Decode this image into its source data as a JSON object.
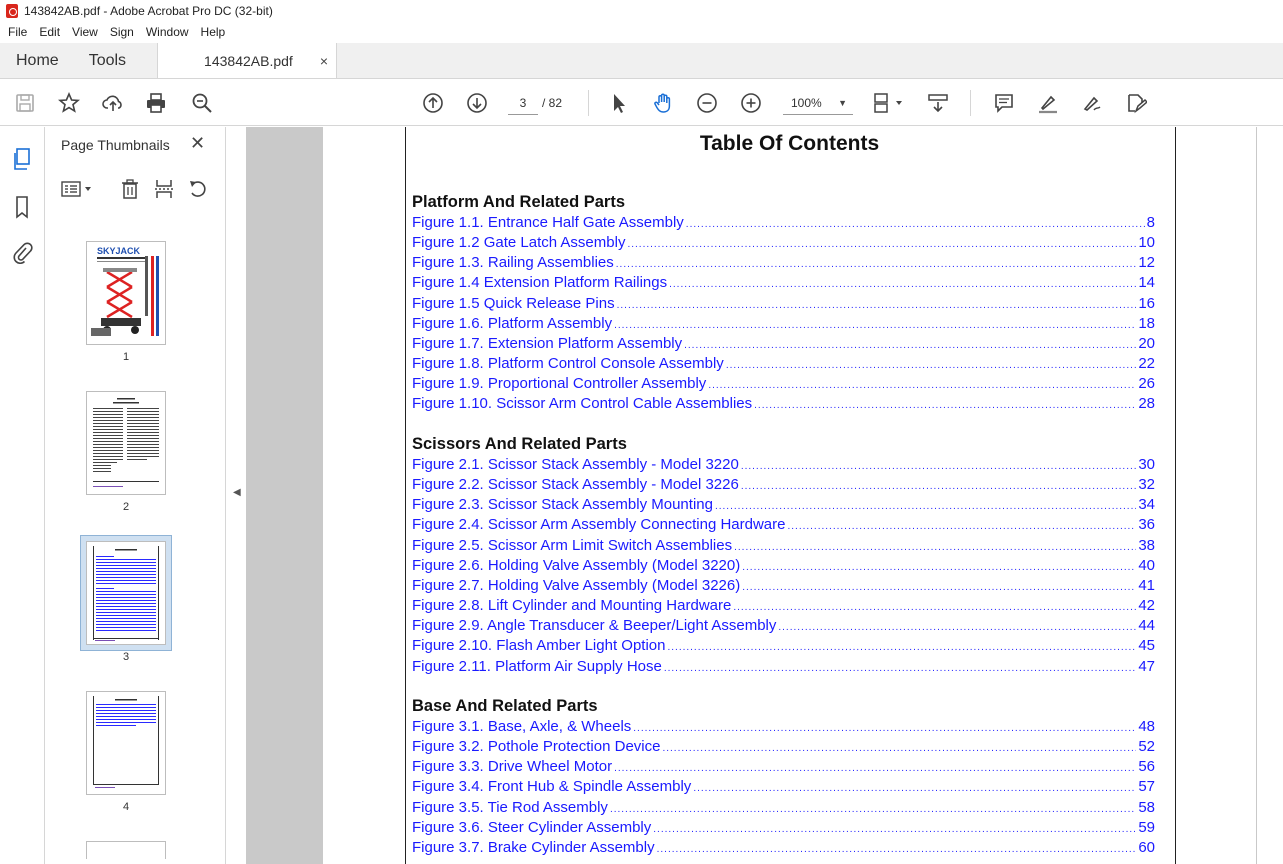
{
  "window": {
    "title": "143842AB.pdf - Adobe Acrobat Pro DC (32-bit)"
  },
  "menu": [
    "File",
    "Edit",
    "View",
    "Sign",
    "Window",
    "Help"
  ],
  "tabs": {
    "home": "Home",
    "tools": "Tools",
    "document": "143842AB.pdf",
    "close": "×"
  },
  "toolbar": {
    "current_page": "3",
    "page_total": "/  82",
    "zoom": "100%",
    "icons": [
      "save-icon",
      "bookmark-star-icon",
      "upload-icon",
      "print-icon",
      "search-zoom-icon",
      "arrow-up-circle-icon",
      "arrow-down-circle-icon",
      "select-cursor-icon",
      "hand-icon",
      "zoom-out-icon",
      "zoom-in-icon",
      "page-layout-icon",
      "scroll-mode-icon",
      "comment-icon",
      "highlight-pen-icon",
      "sign-icon",
      "edit-pdf-icon"
    ]
  },
  "sidebar": {
    "panel_title": "Page Thumbnails",
    "close": "✕",
    "thumbnails": [
      {
        "num": "1"
      },
      {
        "num": "2"
      },
      {
        "num": "3",
        "selected": true
      },
      {
        "num": "4"
      }
    ]
  },
  "document": {
    "title": "Table Of Contents",
    "sections": [
      {
        "heading": "Platform And Related Parts",
        "entries": [
          {
            "label": "Figure 1.1.  Entrance Half Gate Assembly ",
            "page": "8"
          },
          {
            "label": "Figure 1.2   Gate Latch Assembly ",
            "page": "10"
          },
          {
            "label": "Figure 1.3.  Railing Assemblies  ",
            "page": "12"
          },
          {
            "label": "Figure 1.4  Extension Platform Railings",
            "page": "14"
          },
          {
            "label": "Figure 1.5  Quick Release Pins ",
            "page": "16"
          },
          {
            "label": "Figure 1.6.  Platform Assembly",
            "page": "18"
          },
          {
            "label": "Figure 1.7.  Extension Platform Assembly",
            "page": "20"
          },
          {
            "label": "Figure 1.8.  Platform Control Console Assembly ",
            "page": "22"
          },
          {
            "label": "Figure 1.9.  Proportional Controller Assembly ",
            "page": "26"
          },
          {
            "label": "Figure 1.10.  Scissor Arm Control Cable Assemblies ",
            "page": "28"
          }
        ]
      },
      {
        "heading": "Scissors And Related Parts",
        "entries": [
          {
            "label": "Figure 2.1.   Scissor Stack Assembly - Model 3220",
            "page": "30"
          },
          {
            "label": "Figure 2.2.   Scissor Stack Assembly - Model 3226",
            "page": "32"
          },
          {
            "label": "Figure 2.3.  Scissor Stack Assembly Mounting",
            "page": "34"
          },
          {
            "label": "Figure 2.4.  Scissor Arm Assembly Connecting Hardware",
            "page": "36"
          },
          {
            "label": "Figure 2.5. Scissor Arm Limit Switch Assemblies ",
            "page": "38"
          },
          {
            "label": "Figure 2.6. Holding Valve Assembly (Model 3220) ",
            "page": "40"
          },
          {
            "label": "Figure 2.7. Holding Valve Assembly (Model 3226) ",
            "page": "41"
          },
          {
            "label": "Figure 2.8.  Lift Cylinder and Mounting Hardware ",
            "page": "42"
          },
          {
            "label": "Figure 2.9.  Angle Transducer & Beeper/Light Assembly ",
            "page": "44"
          },
          {
            "label": "Figure 2.10. Flash Amber Light Option ",
            "page": "45"
          },
          {
            "label": "Figure 2.11. Platform Air Supply Hose ",
            "page": "47"
          }
        ]
      },
      {
        "heading": "Base And Related Parts",
        "entries": [
          {
            "label": "Figure 3.1. Base, Axle, & Wheels",
            "page": "48"
          },
          {
            "label": "Figure 3.2. Pothole Protection Device ",
            "page": "52"
          },
          {
            "label": "Figure 3.3. Drive Wheel Motor ",
            "page": "56"
          },
          {
            "label": "Figure 3.4. Front Hub & Spindle Assembly ",
            "page": "57"
          },
          {
            "label": "Figure 3.5. Tie Rod Assembly",
            "page": "58"
          },
          {
            "label": "Figure 3.6. Steer Cylinder Assembly ",
            "page": "59"
          },
          {
            "label": "Figure 3.7. Brake Cylinder Assembly ",
            "page": "60"
          }
        ]
      }
    ]
  },
  "colors": {
    "link": "#1a1aff",
    "doc_bg": "#c9c9c9",
    "thumb_selected": "#cfe0f1"
  }
}
